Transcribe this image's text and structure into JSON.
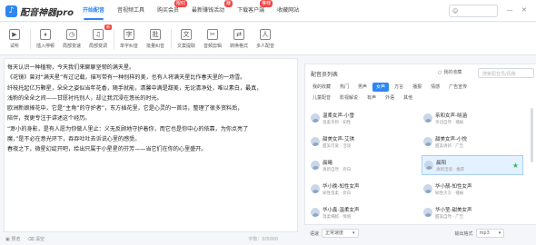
{
  "app": {
    "logo_text": "配音神器pro",
    "logo_glyph": "♪"
  },
  "nav": [
    {
      "label": "开始配音",
      "active": true
    },
    {
      "label": "音视频工具"
    },
    {
      "label": "购买会员",
      "badge": "限时"
    },
    {
      "label": "最新赚钱活动",
      "badge": "赚"
    },
    {
      "label": "下载客户端",
      "badge": "推荐"
    },
    {
      "label": "收藏网站"
    }
  ],
  "user": {
    "placeholder": "",
    "icon": "user-icon"
  },
  "toolbar": [
    {
      "label": "试听",
      "glyph": "▶"
    },
    {
      "label": "插入停顿",
      "glyph": "⏸"
    },
    {
      "label": "局部变速",
      "glyph": "◷"
    },
    {
      "label": "局部变调",
      "glyph": "♫",
      "badge": "新"
    },
    {
      "label": "单字纠音",
      "glyph": "字"
    },
    {
      "label": "批量纠音",
      "glyph": "批"
    },
    {
      "label": "文案提取",
      "glyph": "文"
    },
    {
      "label": "音频剪辑",
      "glyph": "✂"
    },
    {
      "label": "转换格式",
      "glyph": "⇄"
    },
    {
      "label": "多人配音",
      "glyph": "人"
    }
  ],
  "editor": {
    "lines": [
      "每天认识一种植物，今天我们来聊聊坚韧的满天星。",
      "《花镜》曾对“满天星”有过记载，描写带有一种别样的美，也有人将满天星比作春天里的一场雪。",
      "",
      "纤枝托起亿万颗星，朵朵之姿似当年花香，随手就能，清馨中满是甜美，无论清净处，唯以素白，最真，",
      "浅粉的朵朵之间——甘愿衬托别人，却让我沉浸在悠长的时光。",
      "欧洲新娘捧花中，它是“主角”的守护者”，东方插花里，它是心灵的一首诗，整理了很多资料后，",
      "陪伴，我更专注于讲述这个经历。",
      "“渺小的身影，是有人愿为你做人里止：义无反顾地守护着你，而它也是你中心的依靠，为你点亮了",
      "魔，”是不必在意光环下，吞吞吐吐去诉说心里的感受。",
      "春夜之下，微星幻绽开吧，给出只属于小星星的芬芳——当它们在你的心里盛开。"
    ],
    "status_left_1": "预览",
    "status_left_2": "清空",
    "status_right": "字数：0/5000"
  },
  "panel": {
    "title": "配音员列表",
    "toggle_label": "我的收藏",
    "search_placeholder": "搜索配音员/风格",
    "filter_rows": [
      [
        {
          "label": "我的收藏"
        },
        {
          "label": "热门"
        },
        {
          "label": "男声"
        },
        {
          "label": "女声",
          "active": true
        },
        {
          "label": "方言"
        },
        {
          "label": "播报"
        },
        {
          "label": "情感"
        },
        {
          "label": "广告宣传"
        }
      ],
      [
        {
          "label": "儿童配音"
        },
        {
          "label": "影视解说"
        },
        {
          "label": "有声"
        },
        {
          "label": "外语"
        },
        {
          "label": "其他"
        }
      ]
    ],
    "voices": [
      {
        "name": "温柔女声-小雪",
        "desc": "温柔亲和 · 知性",
        "col": 0
      },
      {
        "name": "亲和女声-晓涵",
        "desc": "亲切自然 · 播报",
        "col": 1
      },
      {
        "name": "甜美女声-艾琪",
        "desc": "甜美可爱 · 活泼",
        "col": 0
      },
      {
        "name": "甜美女声-小悦",
        "desc": "甜美清新 · 广告",
        "col": 1
      },
      {
        "name": "晨曦",
        "desc": "清新自然 · 旁白",
        "col": 0
      },
      {
        "name": "晨阳",
        "desc": "清新活泼 · 推荐",
        "col": 1,
        "selected": true,
        "favorite": true
      },
      {
        "name": "华小晚-知性女声",
        "desc": "知性温柔 · 旁白",
        "col": 0
      },
      {
        "name": "华小靓-知性女声",
        "desc": "知性大方 · 播报",
        "col": 1
      },
      {
        "name": "华小鑫-温柔女声",
        "desc": "温柔细腻 · 情感",
        "col": 0
      },
      {
        "name": "华小莹-甜美女声",
        "desc": "甜美自然 · 广告",
        "col": 1
      }
    ]
  },
  "bottom": {
    "speed_label": "语速",
    "speed_value": "正常速度",
    "format_label": "输出格式",
    "format_value": "mp3"
  }
}
